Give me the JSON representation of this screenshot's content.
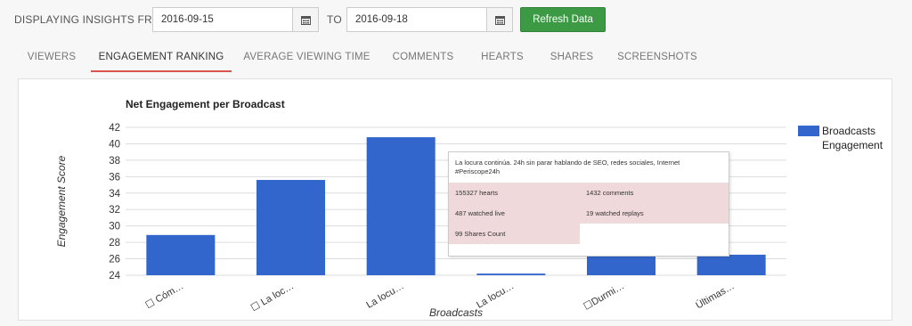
{
  "filters": {
    "label_from": "DISPLAYING INSIGHTS FROM",
    "date_from": "2016-09-15",
    "label_to": "TO",
    "date_to": "2016-09-18",
    "refresh_label": "Refresh Data"
  },
  "tabs": [
    {
      "label": "VIEWERS",
      "active": false
    },
    {
      "label": "ENGAGEMENT RANKING",
      "active": true
    },
    {
      "label": "AVERAGE VIEWING TIME",
      "active": false
    },
    {
      "label": "COMMENTS",
      "active": false
    },
    {
      "label": "HEARTS",
      "active": false
    },
    {
      "label": "SHARES",
      "active": false
    },
    {
      "label": "SCREENSHOTS",
      "active": false
    }
  ],
  "colors": {
    "bar": "#3366cc",
    "accent_tab": "#d9534f",
    "button": "#3c9a44"
  },
  "icons": {
    "calendar": "calendar-icon"
  },
  "chart_data": {
    "type": "bar",
    "title": "Net Engagement per Broadcast",
    "xlabel": "Broadcasts",
    "ylabel": "Engagement Score",
    "ylim": [
      24,
      42
    ],
    "yticks": [
      24,
      26,
      28,
      30,
      32,
      34,
      36,
      38,
      40,
      42
    ],
    "grid": true,
    "legend_position": "right",
    "categories": [
      "☐ Cóm…",
      "☐ La loc…",
      "La locu…",
      "La locu…",
      "☐Durmi…",
      "Últimas…"
    ],
    "series": [
      {
        "name": "Broadcasts Engagement",
        "values": [
          28.9,
          35.6,
          40.8,
          24.2,
          26.5,
          26.5
        ]
      }
    ]
  },
  "tooltip": {
    "title": "La locura continúa. 24h sin parar hablando de SEO, redes sociales, Internet #Periscope24h",
    "hearts": "155327 hearts",
    "comments": "1432 comments",
    "watched_live": "487 watched live",
    "watched_replays": "19 watched replays",
    "shares": "99 Shares Count"
  }
}
